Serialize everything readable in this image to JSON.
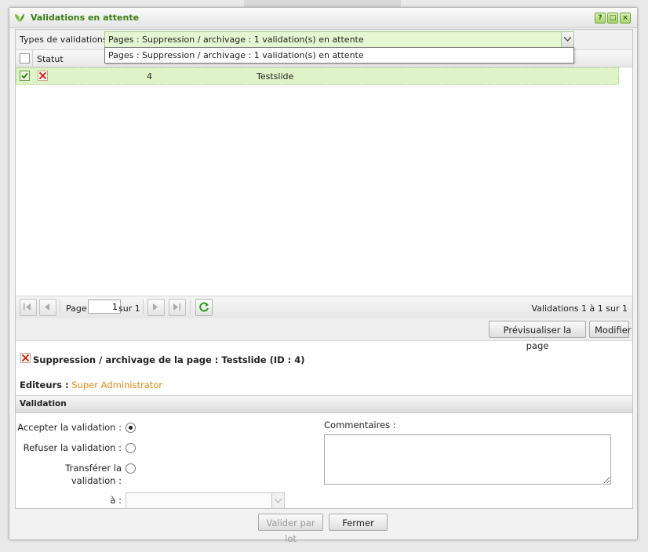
{
  "window": {
    "title": "Validations en attente",
    "controls": [
      "?",
      "□",
      "×"
    ]
  },
  "filter": {
    "label": "Types de validations :",
    "selected": "Pages : Suppression / archivage : 1 validation(s) en attente",
    "options": [
      "Pages : Suppression / archivage : 1 validation(s) en attente"
    ]
  },
  "grid": {
    "columns": [
      "Statut"
    ],
    "rows": [
      {
        "id": "4",
        "name": "Testslide"
      }
    ]
  },
  "pager": {
    "page_label": "Page",
    "page_value": "1",
    "of_label": "sur 1",
    "info": "Validations 1 à 1 sur 1"
  },
  "actions": {
    "preview": "Prévisualiser la page",
    "modify": "Modifier"
  },
  "detail": {
    "title": "Suppression / archivage de la page : Testslide (ID : 4)",
    "editors_label": "Editeurs :",
    "editors_value": "Super Administrator"
  },
  "validation": {
    "section": "Validation",
    "accept": "Accepter la validation :",
    "refuse": "Refuser la validation :",
    "transfer_line1": "Transférer la",
    "transfer_line2": "validation :",
    "to": "à :",
    "comments": "Commentaires :"
  },
  "footer": {
    "batch": "Valider par lot",
    "close": "Fermer"
  },
  "colors": {
    "accent_green": "#3a7d10",
    "row_bg": "#dff3c8",
    "editor_orange": "#e08a14"
  }
}
